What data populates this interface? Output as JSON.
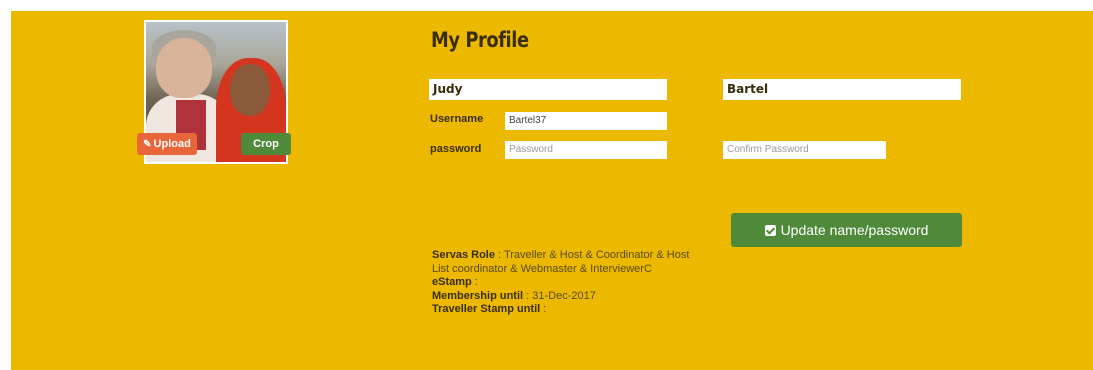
{
  "profile": {
    "title": "My Profile",
    "first_name": "Judy",
    "last_name": "Bartel",
    "username_label": "Username",
    "username_value": "Bartel37",
    "password_label": "password",
    "password_placeholder": "Password",
    "confirm_placeholder": "Confirm Password",
    "update_button": "Update name/password"
  },
  "photo": {
    "upload_label": "Upload",
    "crop_label": "Crop"
  },
  "info": {
    "role_label": "Servas Role",
    "role_value": " : Traveller & Host & Coordinator & Host List coordinator & Webmaster & InterviewerC",
    "estamp_label": "eStamp",
    "estamp_value": " :",
    "membership_label": "Membership until",
    "membership_value": " : 31-Dec-2017",
    "traveller_label": "Traveller Stamp until",
    "traveller_value": " :"
  },
  "icons": {
    "upload": "pencil-icon",
    "update": "check-square-icon"
  },
  "colors": {
    "panel_bg": "#ecb900",
    "button_green": "#4f8a3a",
    "button_orange": "#e8663a"
  }
}
